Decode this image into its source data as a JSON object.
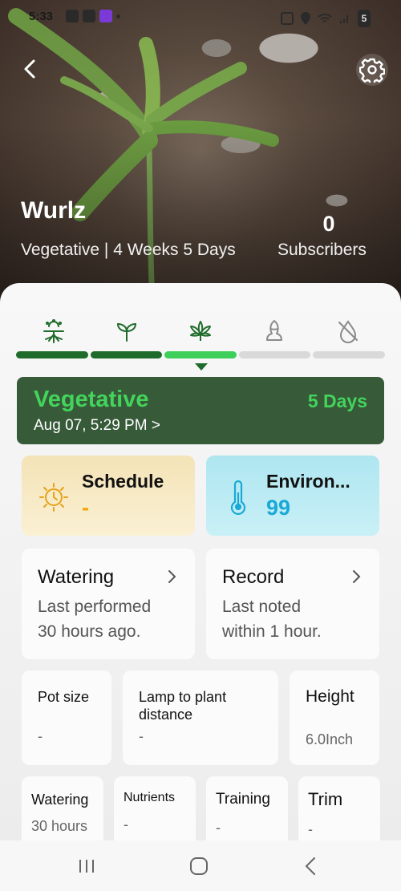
{
  "status_bar": {
    "time": "5:33",
    "battery": "5"
  },
  "header": {
    "plant_name": "Wurlz",
    "stage_line": "Vegetative | 4 Weeks 5 Days",
    "subscribers_count": "0",
    "subscribers_label": "Subscribers"
  },
  "stages": {
    "icons": [
      "germination-icon",
      "seedling-icon",
      "vegetative-leaf-icon",
      "flowering-bud-icon",
      "drying-drop-icon"
    ],
    "progress": [
      "done",
      "done",
      "current",
      "pending",
      "pending"
    ]
  },
  "current_stage": {
    "name": "Vegetative",
    "days": "5 Days",
    "date": "Aug 07, 5:29 PM >"
  },
  "schedule": {
    "title": "Schedule",
    "value": "-",
    "value_color": "#f0a800"
  },
  "environment": {
    "title": "Environ...",
    "value": "99",
    "value_color": "#1aa9d6"
  },
  "watering": {
    "title": "Watering",
    "line1": "Last performed",
    "line2": "30 hours ago."
  },
  "record": {
    "title": "Record",
    "line1": "Last noted",
    "line2": "within 1 hour."
  },
  "metrics": {
    "pot_size": {
      "label": "Pot size",
      "value": "-"
    },
    "lamp": {
      "label_line1": "Lamp to plant",
      "label_line2": "distance",
      "value": "-"
    },
    "height": {
      "label": "Height",
      "value": "6.0Inch"
    }
  },
  "bottom_row": {
    "watering": {
      "label": "Watering",
      "value": "30 hours"
    },
    "nutrients": {
      "label": "Nutrients",
      "value": "-"
    },
    "training": {
      "label": "Training",
      "value": "-"
    },
    "trim": {
      "label": "Trim",
      "value": "-"
    }
  },
  "colors": {
    "brand_green": "#1f6b2b",
    "active_green": "#3ecf5a",
    "stage_card": "#375a39"
  }
}
